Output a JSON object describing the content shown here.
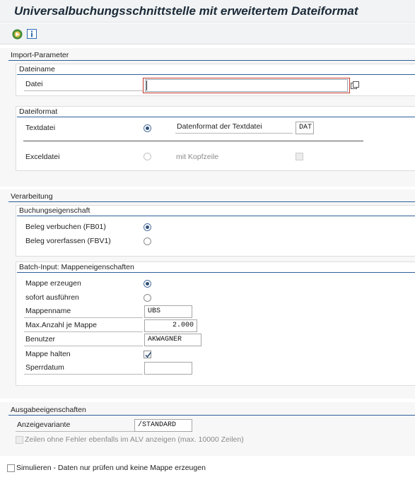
{
  "title": "Universalbuchungsschnittstelle mit erweitertem Dateiformat",
  "toolbar": {
    "execute_icon": "execute-icon",
    "info_icon": "info-icon"
  },
  "import": {
    "group_label": "Import-Parameter",
    "dateiname": {
      "header": "Dateiname",
      "field_label": "Datei",
      "value": ""
    },
    "dateiformat": {
      "header": "Dateiformat",
      "textdatei_label": "Textdatei",
      "textdatei_selected": true,
      "datenformat_label": "Datenformat der Textdatei",
      "datenformat_value": "DAT",
      "exceldatei_label": "Exceldatei",
      "kopfzeile_label": "mit Kopfzeile"
    }
  },
  "verarbeitung": {
    "group_label": "Verarbeitung",
    "buchung": {
      "header": "Buchungseigenschaft",
      "opt1": "Beleg verbuchen (FB01)",
      "opt2": "Beleg vorerfassen (FBV1)"
    },
    "batch": {
      "header": "Batch-Input: Mappeneigenschaften",
      "mappe_erzeugen": "Mappe erzeugen",
      "sofort": "sofort ausführen",
      "mappenname_label": "Mappenname",
      "mappenname_value": "UBS",
      "maxanzahl_label": "Max.Anzahl je Mappe",
      "maxanzahl_value": "2.000",
      "benutzer_label": "Benutzer",
      "benutzer_value": "AKWAGNER",
      "mappe_halten_label": "Mappe halten",
      "mappe_halten_checked": true,
      "sperrdatum_label": "Sperrdatum",
      "sperrdatum_value": ""
    }
  },
  "ausgabe": {
    "group_label": "Ausgabeeigenschaften",
    "variante_label": "Anzeigevariante",
    "variante_value": "/STANDARD",
    "zeilen_label": "Zeilen ohne Fehler ebenfalls im ALV anzeigen (max. 10000 Zeilen)"
  },
  "simulieren_label": "Simulieren - Daten nur prüfen und keine Mappe erzeugen",
  "colors": {
    "accent": "#2f5f9a",
    "focus": "#c0392b",
    "background": "#f7f7f7"
  }
}
